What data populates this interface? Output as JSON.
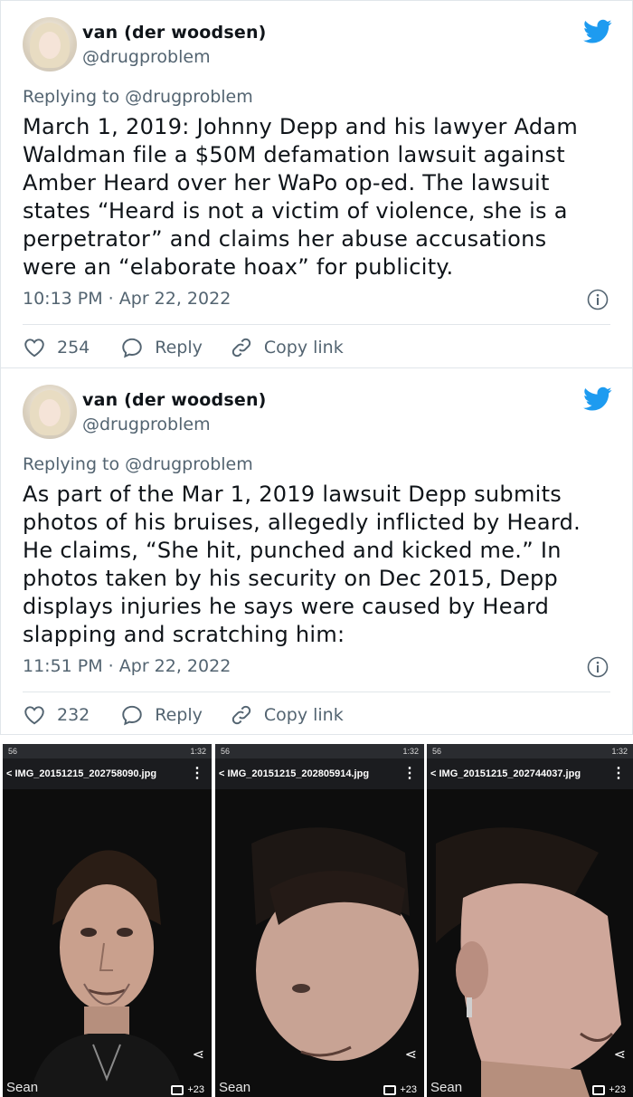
{
  "colors": {
    "accent": "#1d9bf0",
    "text": "#0f1419",
    "muted": "#536471",
    "border": "#e1e6ea"
  },
  "tweets": [
    {
      "user": {
        "name": "van (der woodsen)",
        "handle": "@drugproblem"
      },
      "replying_to": "Replying to @drugproblem",
      "lines": [
        "March 1, 2019: Johnny Depp and his lawyer Adam",
        "Waldman file a $50M defamation lawsuit against",
        "Amber Heard over her WaPo op-ed. The lawsuit",
        "states “Heard is not a victim of violence, she is a",
        "perpetrator” and claims her abuse accusations",
        "were an “elaborate hoax” for publicity."
      ],
      "timestamp": "10:13 PM · Apr 22, 2022",
      "likes": "254",
      "reply_label": "Reply",
      "copy_label": "Copy link"
    },
    {
      "user": {
        "name": "van (der woodsen)",
        "handle": "@drugproblem"
      },
      "replying_to": "Replying to @drugproblem",
      "lines": [
        "As part of the Mar 1, 2019 lawsuit Depp submits",
        "photos of his bruises, allegedly inflicted by Heard.",
        "He claims, “She hit, punched and kicked me.” In",
        "photos taken by his security on Dec 2015, Depp",
        "displays injuries he says were caused by Heard",
        "slapping and scratching him:"
      ],
      "timestamp": "11:51 PM · Apr 22, 2022",
      "likes": "232",
      "reply_label": "Reply",
      "copy_label": "Copy link"
    }
  ],
  "photos": [
    {
      "filename": "< IMG_20151215_202758090.jpg",
      "status_left": "56",
      "time": "1:32",
      "owner": "Sean",
      "count": "+23"
    },
    {
      "filename": "< IMG_20151215_202805914.jpg",
      "status_left": "56",
      "time": "1:32",
      "owner": "Sean",
      "count": "+23"
    },
    {
      "filename": "< IMG_20151215_202744037.jpg",
      "status_left": "56",
      "time": "1:32",
      "owner": "Sean",
      "count": "+23"
    }
  ]
}
